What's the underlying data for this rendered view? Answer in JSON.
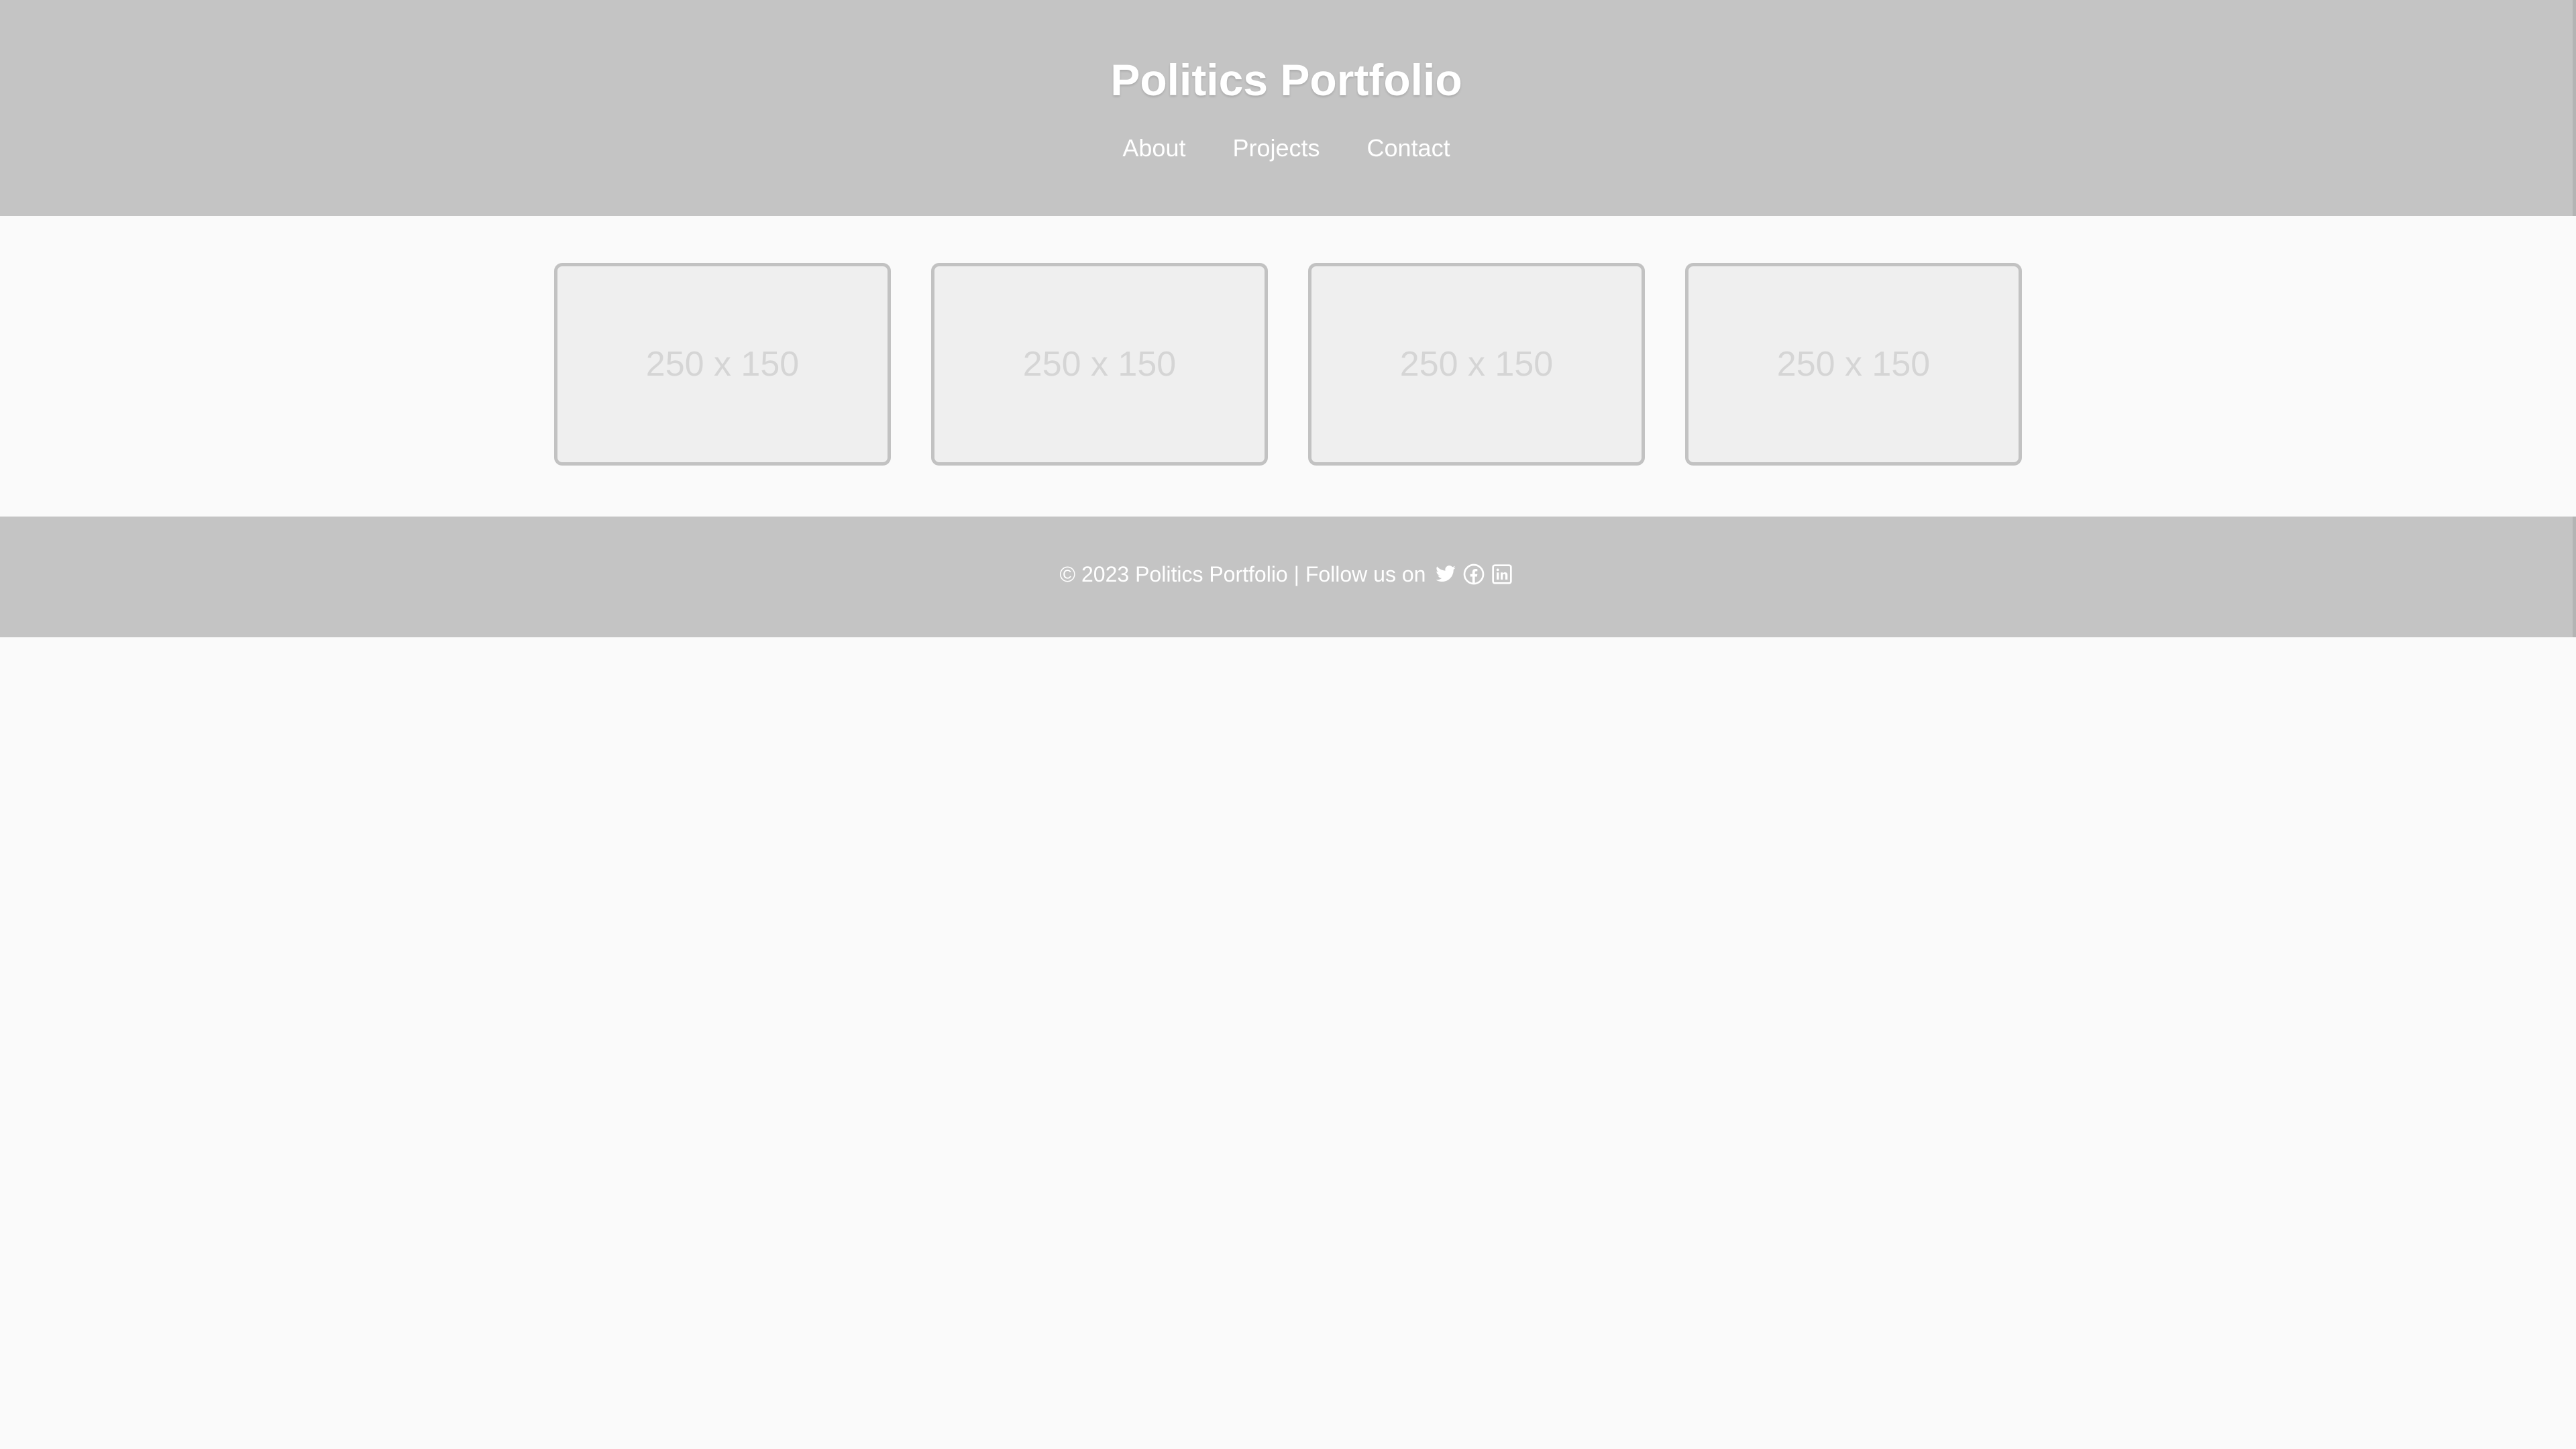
{
  "header": {
    "title": "Politics Portfolio",
    "nav": [
      {
        "label": "About"
      },
      {
        "label": "Projects"
      },
      {
        "label": "Contact"
      }
    ]
  },
  "gallery": {
    "items": [
      {
        "label": "250 x 150"
      },
      {
        "label": "250 x 150"
      },
      {
        "label": "250 x 150"
      },
      {
        "label": "250 x 150"
      }
    ]
  },
  "footer": {
    "text": "© 2023 Politics Portfolio | Follow us on",
    "social_icons": [
      "twitter-icon",
      "facebook-icon",
      "linkedin-icon"
    ]
  },
  "colors": {
    "header_bg": "#c4c4c4",
    "page_bg": "#fafafa",
    "placeholder_bg": "#efefef",
    "placeholder_border": "#c2c2c2",
    "text_light": "#ffffff"
  }
}
